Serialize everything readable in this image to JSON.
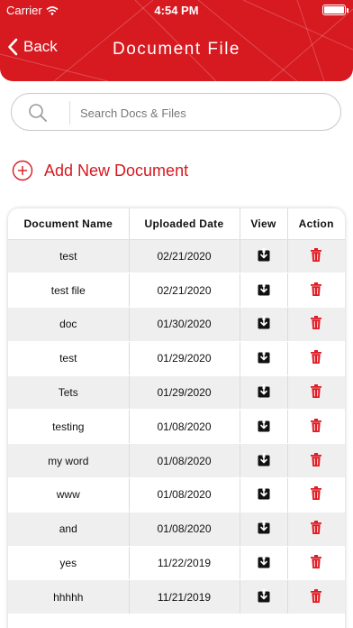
{
  "status_bar": {
    "carrier": "Carrier",
    "time": "4:54 PM",
    "battery_level": 1.0
  },
  "header": {
    "back_label": "Back",
    "title": "Document File",
    "color": "#d71920"
  },
  "search": {
    "placeholder": "Search Docs & Files"
  },
  "add_new": {
    "label": "Add New Document"
  },
  "table": {
    "columns": [
      "Document Name",
      "Uploaded Date",
      "View",
      "Action"
    ],
    "rows": [
      {
        "name": "test",
        "date": "02/21/2020"
      },
      {
        "name": "test file",
        "date": "02/21/2020"
      },
      {
        "name": "doc",
        "date": "01/30/2020"
      },
      {
        "name": "test",
        "date": "01/29/2020"
      },
      {
        "name": "Tets",
        "date": "01/29/2020"
      },
      {
        "name": "testing",
        "date": "01/08/2020"
      },
      {
        "name": "my word",
        "date": "01/08/2020"
      },
      {
        "name": "www",
        "date": "01/08/2020"
      },
      {
        "name": "and",
        "date": "01/08/2020"
      },
      {
        "name": "yes",
        "date": "11/22/2019"
      },
      {
        "name": "hhhhh",
        "date": "11/21/2019"
      }
    ],
    "view_icon": "download-icon",
    "action_icon": "trash-icon"
  }
}
